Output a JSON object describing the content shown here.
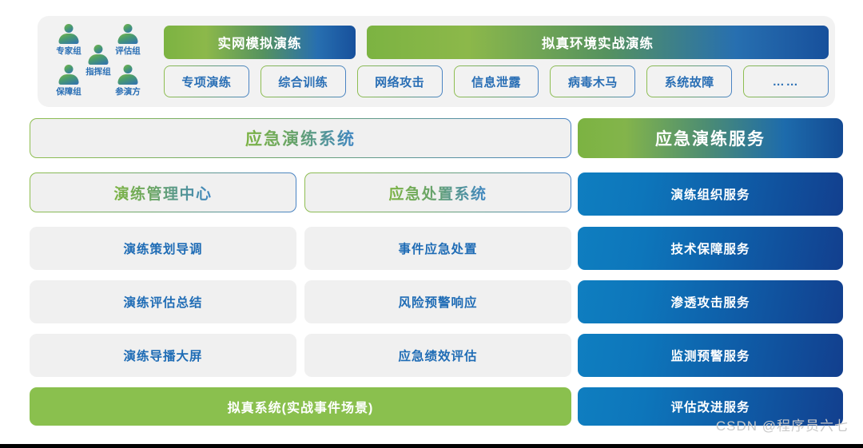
{
  "top_card": {
    "roles": [
      {
        "label": "专家组",
        "icon": "person-icon"
      },
      {
        "label": "评估组",
        "icon": "person-icon"
      },
      {
        "label": "指挥组",
        "icon": "person-icon"
      },
      {
        "label": "保障组",
        "icon": "person-icon"
      },
      {
        "label": "参演方",
        "icon": "person-icon"
      }
    ],
    "banners": [
      {
        "label": "实网模拟演练"
      },
      {
        "label": "拟真环境实战演练"
      }
    ],
    "pills": [
      {
        "label": "专项演练"
      },
      {
        "label": "综合训练"
      },
      {
        "label": "网络攻击"
      },
      {
        "label": "信息泄露"
      },
      {
        "label": "病毒木马"
      },
      {
        "label": "系统故障"
      },
      {
        "label": "……"
      }
    ]
  },
  "left": {
    "system_title": "应急演练系统",
    "subsystems": [
      {
        "label": "演练管理中心"
      },
      {
        "label": "应急处置系统"
      }
    ],
    "rows": [
      [
        {
          "label": "演练策划导调"
        },
        {
          "label": "事件应急处置"
        }
      ],
      [
        {
          "label": "演练评估总结"
        },
        {
          "label": "风险预警响应"
        }
      ],
      [
        {
          "label": "演练导播大屏"
        },
        {
          "label": "应急绩效评估"
        }
      ]
    ],
    "footer": "拟真系统(实战事件场景)"
  },
  "right": {
    "service_title": "应急演练服务",
    "services": [
      {
        "label": "演练组织服务"
      },
      {
        "label": "技术保障服务"
      },
      {
        "label": "渗透攻击服务"
      },
      {
        "label": "监测预警服务"
      },
      {
        "label": "评估改进服务"
      }
    ]
  },
  "watermark": "CSDN @程序员六七",
  "colors": {
    "green": "#8ac04e",
    "blue": "#1f6cb5",
    "navy": "#134a93",
    "cell_bg": "#f0f0f0",
    "card_bg": "#f2f2f2"
  }
}
